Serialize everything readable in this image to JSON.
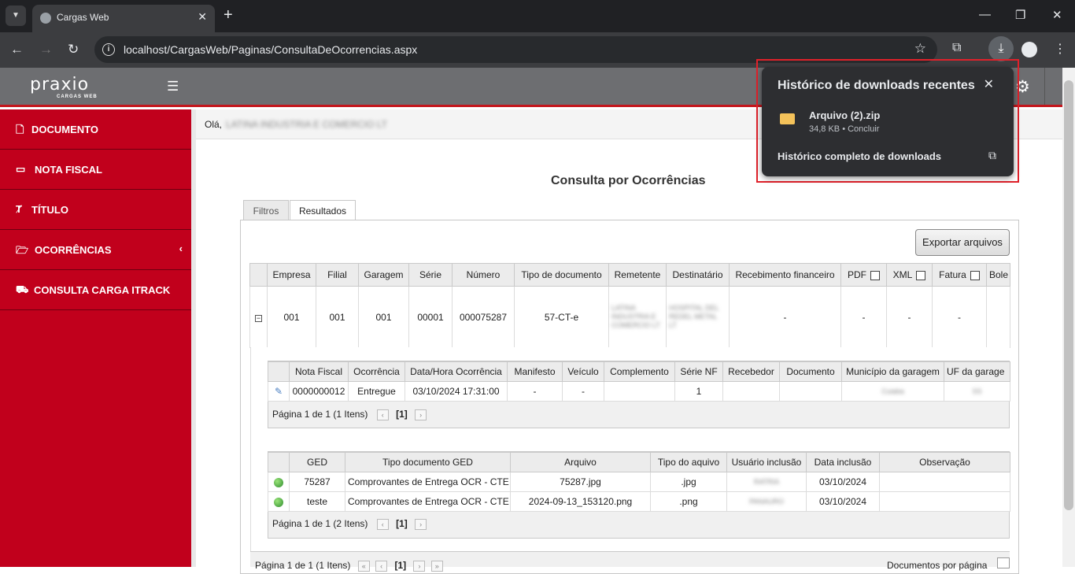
{
  "browser": {
    "tab_title": "Cargas Web",
    "url": "localhost/CargasWeb/Paginas/ConsultaDeOcorrencias.aspx"
  },
  "header": {
    "logo": "praxio",
    "logo_sub": "CARGAS WEB"
  },
  "sidebar": {
    "items": [
      {
        "label": "DOCUMENTO",
        "icon": "document-icon"
      },
      {
        "label": "NOTA FISCAL",
        "icon": "card-icon"
      },
      {
        "label": "TÍTULO",
        "icon": "title-icon"
      },
      {
        "label": "OCORRÊNCIAS",
        "icon": "folder-icon"
      },
      {
        "label": "CONSULTA CARGA ITRACK",
        "icon": "truck-icon"
      }
    ]
  },
  "welcome": {
    "greeting": "Olá,",
    "company": "LATINA INDUSTRIA E COMERCIO LT"
  },
  "page": {
    "title": "Consulta por Ocorrências",
    "tabs": [
      "Filtros",
      "Resultados"
    ],
    "export_label": "Exportar arquivos"
  },
  "main_grid": {
    "headers": [
      "Empresa",
      "Filial",
      "Garagem",
      "Série",
      "Número",
      "Tipo de documento",
      "Remetente",
      "Destinatário",
      "Recebimento financeiro",
      "PDF",
      "XML",
      "Fatura",
      "Bole"
    ],
    "row": {
      "empresa": "001",
      "filial": "001",
      "garagem": "001",
      "serie": "00001",
      "numero": "000075287",
      "tipo": "57-CT-e",
      "remetente": "LATINA INDUSTRIA E COMERCIO LT",
      "destinatario": "HOSPITAL DEL REDEL METAL LT",
      "recebimento": "-",
      "pdf": "-",
      "xml": "-",
      "fatura": "-"
    }
  },
  "ocorrencias_grid": {
    "headers": [
      "Nota Fiscal",
      "Ocorrência",
      "Data/Hora Ocorrência",
      "Manifesto",
      "Veículo",
      "Complemento",
      "Série NF",
      "Recebedor",
      "Documento",
      "Município da garagem",
      "UF da garage"
    ],
    "row": {
      "nota": "0000000012",
      "ocorrencia": "Entregue",
      "data": "03/10/2024 17:31:00",
      "manifesto": "-",
      "veiculo": "-",
      "complemento": "",
      "serie_nf": "1",
      "recebedor": "",
      "documento": "",
      "municipio": "Cuiaba",
      "uf": "SS"
    },
    "pager": "Página 1 de 1 (1 Itens)",
    "page_current": "[1]"
  },
  "ged_grid": {
    "headers": [
      "GED",
      "Tipo documento GED",
      "Arquivo",
      "Tipo do aquivo",
      "Usuário inclusão",
      "Data inclusão",
      "Observação"
    ],
    "rows": [
      {
        "ged": "75287",
        "tipo": "Comprovantes de Entrega OCR - CTE",
        "arquivo": "75287.jpg",
        "ext": ".jpg",
        "usuario": "RATRIA",
        "data": "03/10/2024",
        "obs": ""
      },
      {
        "ged": "teste",
        "tipo": "Comprovantes de Entrega OCR - CTE",
        "arquivo": "2024-09-13_153120.png",
        "ext": ".png",
        "usuario": "PANAURO",
        "data": "03/10/2024",
        "obs": ""
      }
    ],
    "pager": "Página 1 de 1 (2 Itens)",
    "page_current": "[1]"
  },
  "footer_pager": {
    "text": "Página 1 de 1 (1 Itens)",
    "page_current": "[1]",
    "page_size_label": "Documentos por página"
  },
  "downloads": {
    "title": "Histórico de downloads recentes",
    "file": "Arquivo (2).zip",
    "meta": "34,8 KB • Concluir",
    "all": "Histórico completo de downloads"
  }
}
